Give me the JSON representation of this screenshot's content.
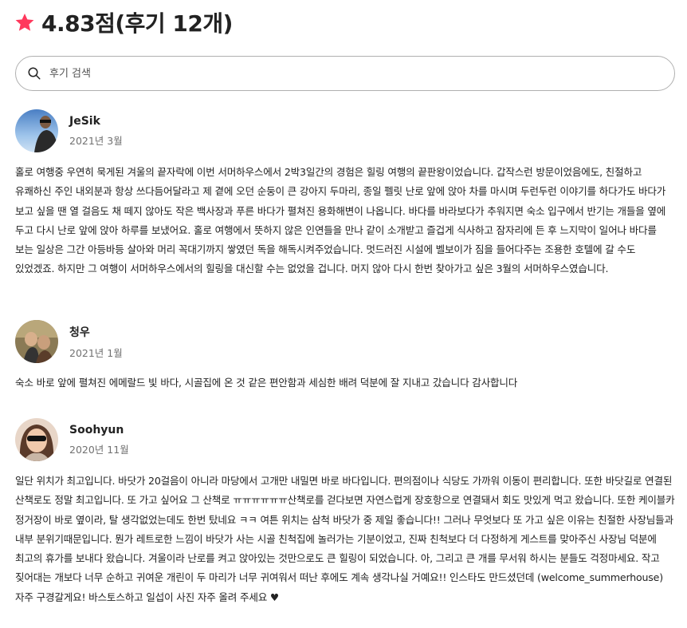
{
  "header": {
    "rating_title": "4.83점(후기 12개)",
    "star_color": "#FF385C"
  },
  "search": {
    "placeholder": "후기 검색",
    "icon": "search-icon"
  },
  "reviews": [
    {
      "author": "JeSik",
      "date": "2021년 3월",
      "text": "홀로 여행중 우연히 묵게된 겨울의 끝자락에 이번 서머하우스에서 2박3일간의 경험은 힐링 여행의 끝판왕이었습니다. 갑작스런 방문이었음에도, 친절하고 유쾌하신 주인 내외분과 항상 쓰다듬어달라고 제 곁에 오던 순둥이 큰 강아지 두마리, 종일 펠릿 난로 앞에 앉아 차를 마시며 두런두런 이야기를 하다가도 바다가 보고 싶을 땐 열 걸음도 채 떼지 않아도 작은 백사장과 푸른 바다가 펼쳐진 용화해변이 나옵니다. 바다를 바라보다가 추워지면 숙소 입구에서 반기는 개들을 옆에 두고 다시 난로 앞에 앉아 하루를 보냈어요. 홀로 여행에서 뜻하지 않은 인연들을 만나 같이 소개받고 즐겁게 식사하고 잠자리에 든 후 느지막이 일어나 바다를 보는 일상은 그간 아등바등 살아와 머리 꼭대기까지 쌓였던 독을 해독시켜주었습니다. 멋드러진 시설에 벨보이가 짐을 들어다주는 조용한 호텔에 갈 수도 있었겠죠. 하지만 그 여행이 서머하우스에서의 힐링을 대신할 수는 없었을 겁니다. 머지 않아 다시 한번 찾아가고 싶은 3월의 서머하우스였습니다."
    },
    {
      "author": "청우",
      "date": "2021년 1월",
      "text": "숙소 바로 앞에 펼쳐진 에메랄드 빛 바다, 시골집에 온 것 같은 편안함과 세심한 배려 덕분에 잘 지내고 갔습니다 감사합니다"
    },
    {
      "author": "Soohyun",
      "date": "2020년 11월",
      "text": "일단 위치가 최고입니다. 바닷가 20걸음이 아니라 마당에서 고개만 내밀면 바로 바다입니다. 편의점이나 식당도 가까워 이동이 편리합니다. 또한 바닷길로 연결된 산책로도 정말 최고입니다. 또 가고 싶어요 그 산책로 ㅠㅠㅠㅠㅠㅠ산책로를 걷다보면 자연스럽게 장호항으로 연결돼서 회도 맛있게 먹고 왔습니다. 또한 케이블카 정거장이 바로 옆이라, 탈 생각없었는데도 한번 탔네요 ㅋㅋ 여튼 위치는 삼척 바닷가 중 제일 좋습니다!! 그러나 무엇보다 또 가고 싶은 이유는 친절한 사장님들과 내부 분위기때문입니다. 뭔가 레트로한 느낌이 바닷가 사는 시골 친척집에 놀러가는 기분이었고, 진짜 친척보다 더 다정하게 게스트를 맞아주신 사장님 덕분에 최고의 휴가를 보내다 왔습니다. 겨울이라 난로를 켜고 앉아있는 것만으로도 큰 힐링이 되었습니다. 아, 그리고 큰 개를 무서워 하시는 분들도 걱정마세요. 작고 짖어대는 개보다 너무 순하고 귀여운 개린이 두 마리가 너무 귀여워서 떠난 후에도 계속 생각나실 거예요!! 인스타도 만드셨던데 (welcome_summerhouse) 자주 구경갈게요! 바스토스하고 일섭이 사진 자주 올려 주세요 ♥"
    }
  ]
}
